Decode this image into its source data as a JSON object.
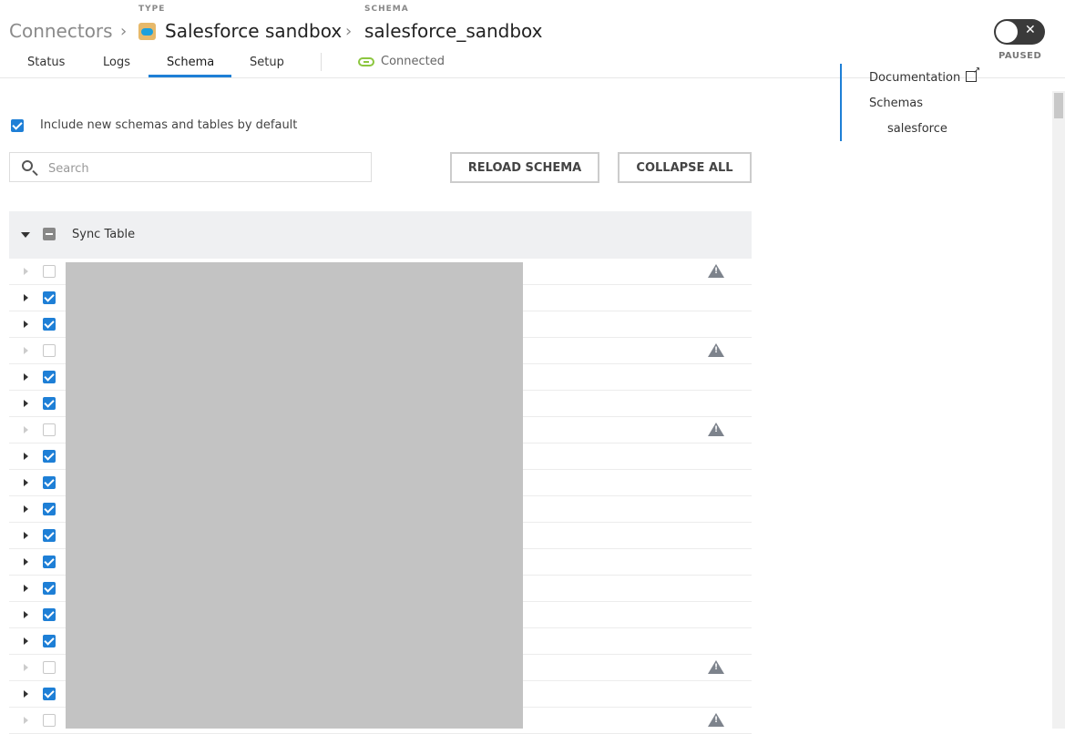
{
  "breadcrumb": {
    "root": "Connectors",
    "type_label": "TYPE",
    "connector_name": "Salesforce sandbox",
    "schema_label": "SCHEMA",
    "schema_name": "salesforce_sandbox"
  },
  "tabs": [
    {
      "label": "Status"
    },
    {
      "label": "Logs"
    },
    {
      "label": "Schema",
      "active": true
    },
    {
      "label": "Setup"
    }
  ],
  "connection": {
    "status": "Connected",
    "color": "#8cc63f"
  },
  "toggle": {
    "state_label": "PAUSED",
    "on": false
  },
  "side_nav": {
    "documentation": "Documentation",
    "schemas": "Schemas",
    "schema_item": "salesforce"
  },
  "include_default": {
    "label": "Include new schemas and tables by default",
    "checked": true
  },
  "search": {
    "placeholder": "Search",
    "value": ""
  },
  "buttons": {
    "reload": "RELOAD SCHEMA",
    "collapse": "COLLAPSE ALL"
  },
  "table": {
    "header": "Sync Table",
    "rows": [
      {
        "checked": false,
        "warning": true
      },
      {
        "checked": true,
        "warning": false
      },
      {
        "checked": true,
        "warning": false
      },
      {
        "checked": false,
        "warning": true
      },
      {
        "checked": true,
        "warning": false
      },
      {
        "checked": true,
        "warning": false
      },
      {
        "checked": false,
        "warning": true
      },
      {
        "checked": true,
        "warning": false
      },
      {
        "checked": true,
        "warning": false
      },
      {
        "checked": true,
        "warning": false
      },
      {
        "checked": true,
        "warning": false
      },
      {
        "checked": true,
        "warning": false
      },
      {
        "checked": true,
        "warning": false
      },
      {
        "checked": true,
        "warning": false
      },
      {
        "checked": true,
        "warning": false
      },
      {
        "checked": false,
        "warning": true
      },
      {
        "checked": true,
        "warning": false
      },
      {
        "checked": false,
        "warning": true
      }
    ]
  },
  "colors": {
    "accent": "#1e7fd6",
    "warning_icon": "#7d838c",
    "toggle_bg": "#3a3a3a"
  }
}
